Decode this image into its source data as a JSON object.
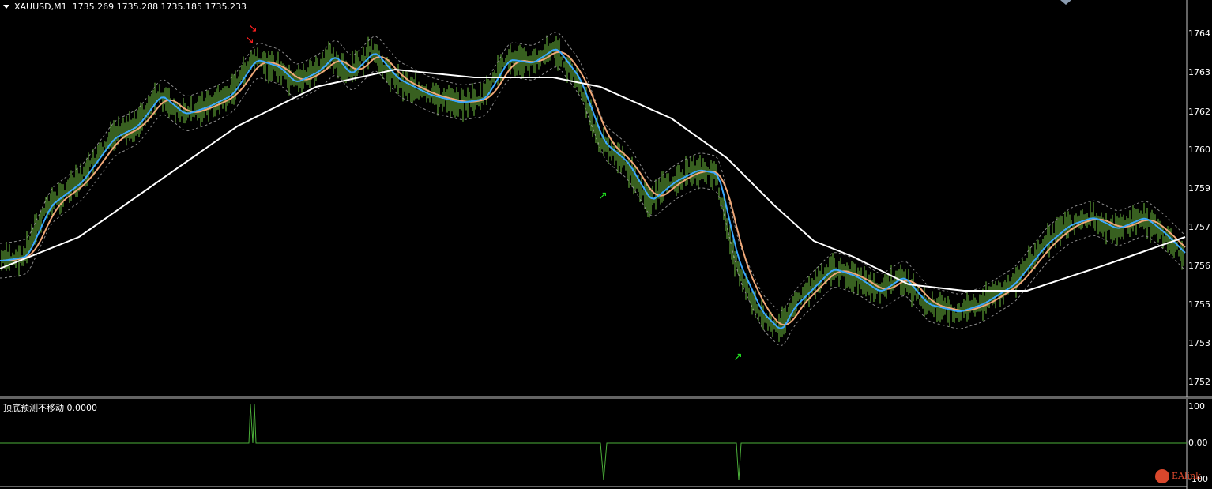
{
  "symbol_header": "XAUUSD,M1  1735.269 1735.288 1735.185 1735.233",
  "indicator_header": "顶底预测不移动 0.0000",
  "price_axis_labels": [
    "1764",
    "1763",
    "1762",
    "1760",
    "1759",
    "1757",
    "1756",
    "1755",
    "1753",
    "1752"
  ],
  "indicator_axis_labels": [
    "100",
    "0.00",
    "-100"
  ],
  "watermark": "EAlink",
  "colors": {
    "background": "#000000",
    "bars": "#6fbf3f",
    "ema_fast": "#3aa8ff",
    "ema_mid": "#f0a878",
    "ma_slow": "#ffffff",
    "band": "#8a8a8a",
    "arrow_down": "#ff2020",
    "arrow_up": "#20e020",
    "indicator_line": "#4caf3a"
  },
  "icons": {
    "collapse": "triangle-down-icon",
    "arrow_down": "arrow-down-right-icon",
    "arrow_up": "arrow-up-right-icon"
  }
}
